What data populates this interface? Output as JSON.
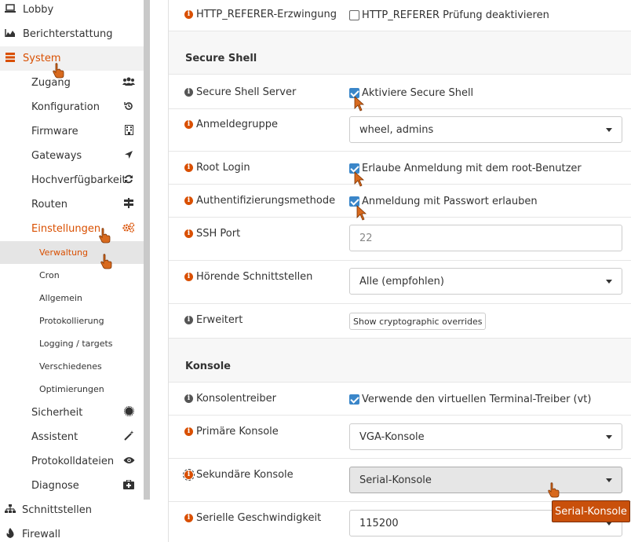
{
  "sidebar": {
    "top_items": [
      {
        "label": "Lobby",
        "icon": "laptop-icon"
      },
      {
        "label": "Berichterstattung",
        "icon": "area-chart-icon"
      },
      {
        "label": "System",
        "icon": "server-icon"
      }
    ],
    "system_items": [
      {
        "label": "Zugang",
        "icon": "users-icon"
      },
      {
        "label": "Konfiguration",
        "icon": "history-icon"
      },
      {
        "label": "Firmware",
        "icon": "building-icon"
      },
      {
        "label": "Gateways",
        "icon": "location-arrow-icon"
      },
      {
        "label": "Hochverfügbarkeit",
        "icon": "refresh-icon"
      },
      {
        "label": "Routen",
        "icon": "map-signs-icon"
      },
      {
        "label": "Einstellungen",
        "icon": "cogs-icon"
      }
    ],
    "settings_items": [
      {
        "label": "Verwaltung"
      },
      {
        "label": "Cron"
      },
      {
        "label": "Allgemein"
      },
      {
        "label": "Protokollierung"
      },
      {
        "label": "Logging / targets"
      },
      {
        "label": "Verschiedenes"
      },
      {
        "label": "Optimierungen"
      }
    ],
    "system_items_after": [
      {
        "label": "Sicherheit",
        "icon": "certificate-icon"
      },
      {
        "label": "Assistent",
        "icon": "magic-icon"
      },
      {
        "label": "Protokolldateien",
        "icon": "eye-icon"
      },
      {
        "label": "Diagnose",
        "icon": "medkit-icon"
      }
    ],
    "bottom_items": [
      {
        "label": "Schnittstellen",
        "icon": "sitemap-icon"
      },
      {
        "label": "Firewall",
        "icon": "fire-icon"
      }
    ]
  },
  "main": {
    "http_referer": {
      "label": "HTTP_REFERER-Erzwingung",
      "checkbox_label": "HTTP_REFERER Prüfung deaktivieren",
      "checked": false
    },
    "secure_shell": {
      "title": "Secure Shell",
      "server": {
        "label": "Secure Shell Server",
        "checkbox_label": "Aktiviere Secure Shell",
        "checked": true
      },
      "login_group": {
        "label": "Anmeldegruppe",
        "value": "wheel, admins"
      },
      "root_login": {
        "label": "Root Login",
        "checkbox_label": "Erlaube Anmeldung mit dem root-Benutzer",
        "checked": true
      },
      "auth_method": {
        "label": "Authentifizierungsmethode",
        "checkbox_label": "Anmeldung mit Passwort erlauben",
        "checked": true
      },
      "ssh_port": {
        "label": "SSH Port",
        "placeholder": "22"
      },
      "listen_interfaces": {
        "label": "Hörende Schnittstellen",
        "value": "Alle (empfohlen)"
      },
      "advanced": {
        "label": "Erweitert",
        "button": "Show cryptographic overrides"
      }
    },
    "console": {
      "title": "Konsole",
      "driver": {
        "label": "Konsolentreiber",
        "checkbox_label": "Verwende den virtuellen Terminal-Treiber (vt)",
        "checked": true
      },
      "primary": {
        "label": "Primäre Konsole",
        "value": "VGA-Konsole"
      },
      "secondary": {
        "label": "Sekundäre Konsole",
        "value": "Serial-Konsole"
      },
      "serial_speed": {
        "label": "Serielle Geschwindigkeit",
        "value": "115200"
      }
    },
    "tooltip": "Serial-Konsole"
  },
  "colors": {
    "accent": "#d94f00",
    "checkbox": "#3a86c9",
    "tooltip_bg": "#c9500b"
  }
}
